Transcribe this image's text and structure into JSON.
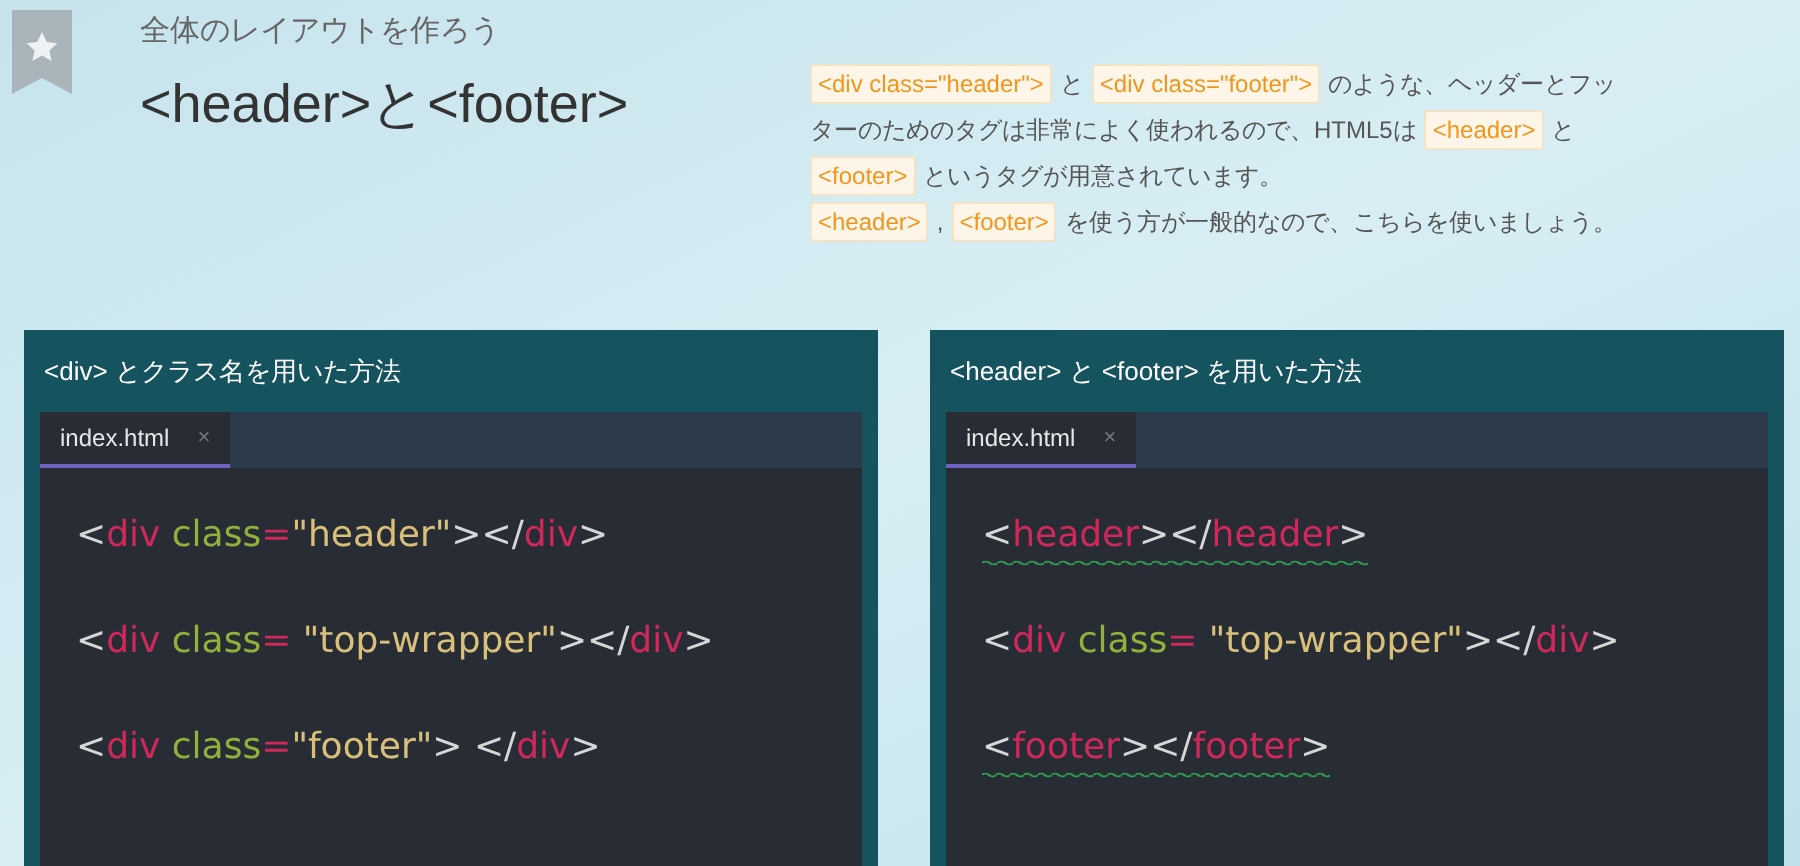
{
  "header": {
    "subtitle": "全体のレイアウトを作ろう",
    "title": "<header>と<footer>"
  },
  "description": {
    "lines": [
      [
        {
          "kind": "code",
          "text": "<div class=\"header\">"
        },
        {
          "kind": "text",
          "text": "と"
        },
        {
          "kind": "code",
          "text": "<div class=\"footer\">"
        },
        {
          "kind": "text",
          "text": "のような、ヘッダーとフッ"
        }
      ],
      [
        {
          "kind": "text",
          "text": "ターのためのタグは非常によく使われるので、HTML5は"
        },
        {
          "kind": "code",
          "text": "<header>"
        },
        {
          "kind": "text",
          "text": "と"
        }
      ],
      [
        {
          "kind": "code",
          "text": "<footer>"
        },
        {
          "kind": "text",
          "text": "というタグが用意されています。"
        }
      ],
      [
        {
          "kind": "code",
          "text": "<header>"
        },
        {
          "kind": "text",
          "text": ","
        },
        {
          "kind": "code",
          "text": "<footer>"
        },
        {
          "kind": "text",
          "text": "を使う方が一般的なので、こちらを使いましょう。"
        }
      ]
    ]
  },
  "panels": [
    {
      "title": "<div> とクラス名を用いた方法",
      "tab": {
        "label": "index.html",
        "close": "×",
        "selected": true
      },
      "lines": [
        {
          "squiggle": false,
          "tokens": [
            {
              "kind": "punct",
              "text": "<"
            },
            {
              "kind": "tag",
              "text": "div"
            },
            {
              "kind": "attr",
              "text": " class"
            },
            {
              "kind": "tag",
              "text": "="
            },
            {
              "kind": "string",
              "text": "\"header\""
            },
            {
              "kind": "punct",
              "text": "></"
            },
            {
              "kind": "tag",
              "text": "div"
            },
            {
              "kind": "punct",
              "text": ">"
            }
          ]
        },
        {
          "squiggle": false,
          "tokens": [
            {
              "kind": "punct",
              "text": "<"
            },
            {
              "kind": "tag",
              "text": "div"
            },
            {
              "kind": "attr",
              "text": " class"
            },
            {
              "kind": "tag",
              "text": "= "
            },
            {
              "kind": "string",
              "text": "\"top-wrapper\""
            },
            {
              "kind": "punct",
              "text": "></"
            },
            {
              "kind": "tag",
              "text": "div"
            },
            {
              "kind": "punct",
              "text": ">"
            }
          ]
        },
        {
          "squiggle": false,
          "tokens": [
            {
              "kind": "punct",
              "text": "<"
            },
            {
              "kind": "tag",
              "text": "div"
            },
            {
              "kind": "attr",
              "text": " class"
            },
            {
              "kind": "tag",
              "text": "="
            },
            {
              "kind": "string",
              "text": "\"footer\""
            },
            {
              "kind": "punct",
              "text": "> </"
            },
            {
              "kind": "tag",
              "text": "div"
            },
            {
              "kind": "punct",
              "text": ">"
            }
          ]
        }
      ]
    },
    {
      "title": "<header> と <footer> を用いた方法",
      "tab": {
        "label": "index.html",
        "close": "×",
        "selected": true
      },
      "lines": [
        {
          "squiggle": true,
          "tokens": [
            {
              "kind": "punct",
              "text": "<"
            },
            {
              "kind": "tag",
              "text": "header"
            },
            {
              "kind": "punct",
              "text": "></"
            },
            {
              "kind": "tag",
              "text": "header"
            },
            {
              "kind": "punct",
              "text": ">"
            }
          ]
        },
        {
          "squiggle": false,
          "tokens": [
            {
              "kind": "punct",
              "text": "<"
            },
            {
              "kind": "tag",
              "text": "div"
            },
            {
              "kind": "attr",
              "text": " class"
            },
            {
              "kind": "tag",
              "text": "= "
            },
            {
              "kind": "string",
              "text": "\"top-wrapper\""
            },
            {
              "kind": "punct",
              "text": "></"
            },
            {
              "kind": "tag",
              "text": "div"
            },
            {
              "kind": "punct",
              "text": ">"
            }
          ]
        },
        {
          "squiggle": true,
          "tokens": [
            {
              "kind": "punct",
              "text": "<"
            },
            {
              "kind": "tag",
              "text": "footer"
            },
            {
              "kind": "punct",
              "text": "></"
            },
            {
              "kind": "tag",
              "text": "footer"
            },
            {
              "kind": "punct",
              "text": ">"
            }
          ]
        }
      ]
    }
  ]
}
